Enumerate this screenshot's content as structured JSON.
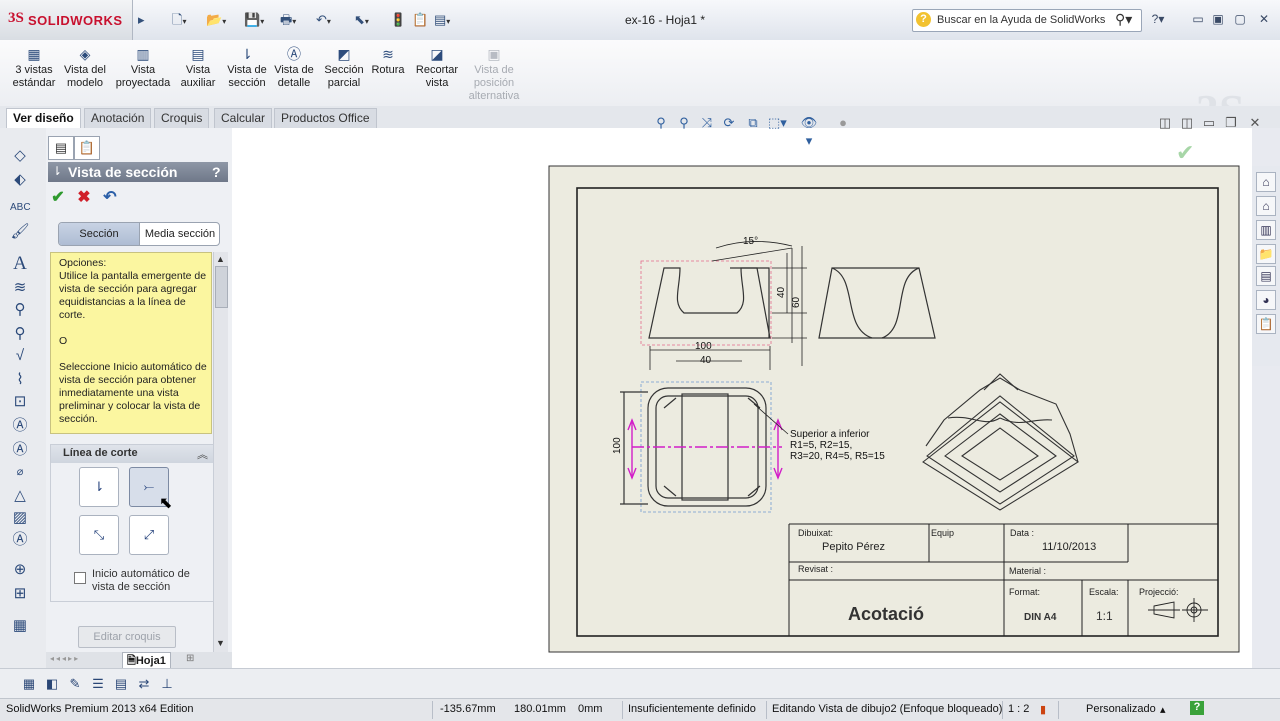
{
  "app": {
    "brand": "SOLIDWORKS",
    "document_title": "ex-16 - Hoja1 *",
    "help_search_placeholder": "Buscar en la Ayuda de SolidWorks"
  },
  "ribbon": {
    "buttons": [
      {
        "label": "3 vistas\nestándar",
        "icon": "three-views-icon"
      },
      {
        "label": "Vista del\nmodelo",
        "icon": "model-view-icon"
      },
      {
        "label": "Vista\nproyectada",
        "icon": "projected-view-icon"
      },
      {
        "label": "Vista\nauxiliar",
        "icon": "auxiliary-view-icon"
      },
      {
        "label": "Vista de\nsección",
        "icon": "section-view-icon"
      },
      {
        "label": "Vista de\ndetalle",
        "icon": "detail-view-icon"
      },
      {
        "label": "Sección\nparcial",
        "icon": "broken-out-section-icon"
      },
      {
        "label": "Rotura",
        "icon": "break-icon"
      },
      {
        "label": "Recortar\nvista",
        "icon": "crop-view-icon"
      },
      {
        "label": "Vista de\nposición\nalternativa",
        "icon": "alternate-position-icon",
        "disabled": true
      }
    ]
  },
  "tabs": [
    "Ver diseño",
    "Anotación",
    "Croquis",
    "Calcular",
    "Productos Office"
  ],
  "active_tab": "Ver diseño",
  "property_manager": {
    "title": "Vista de sección",
    "help": "?",
    "segments": [
      "Sección",
      "Media sección"
    ],
    "selected_segment": "Sección",
    "options_heading": "Opciones:",
    "options_text_1": "Utilice la pantalla emergente de vista de sección para agregar equidistancias a la línea de corte.",
    "options_or": "O",
    "options_text_2": "Seleccione Inicio automático de vista de sección para obtener inmediatamente una vista preliminar y colocar la vista de sección.",
    "cutting_line_group": "Línea de corte",
    "auto_start_label": "Inicio automático de vista de sección",
    "auto_start_checked": false,
    "edit_sketch_label": "Editar croquis"
  },
  "sheet_tab": "Hoja1",
  "drawing": {
    "angle_dim": "15°",
    "dim_40_vertical": "40",
    "dim_60_vertical": "60",
    "dim_100_horizontal": "100",
    "dim_40_horizontal": "40",
    "dim_100_vertical": "100",
    "note_line1": "Superior a inferior",
    "note_line2": "R1=5, R2=15,",
    "note_line3": "R3=20, R4=5, R5=15",
    "title_block": {
      "drawn_by_label": "Dibuixat:",
      "drawn_by_value": "Pepito Pérez",
      "team_label": "Equip",
      "date_label": "Data :",
      "date_value": "11/10/2013",
      "revised_label": "Revisat :",
      "material_label": "Material :",
      "title": "Acotació",
      "format_label": "Format:",
      "format_value": "DIN A4",
      "scale_label": "Escala:",
      "scale_value": "1:1",
      "projection_label": "Projecció:"
    }
  },
  "status": {
    "product": "SolidWorks Premium 2013 x64 Edition",
    "x": "-135.67mm",
    "y": "180.01mm",
    "z": "0mm",
    "definition": "Insuficientemente definido",
    "mode": "Editando Vista de dibujo2 (Enfoque bloqueado)",
    "scale": "1 : 2",
    "units": "Personalizado"
  }
}
